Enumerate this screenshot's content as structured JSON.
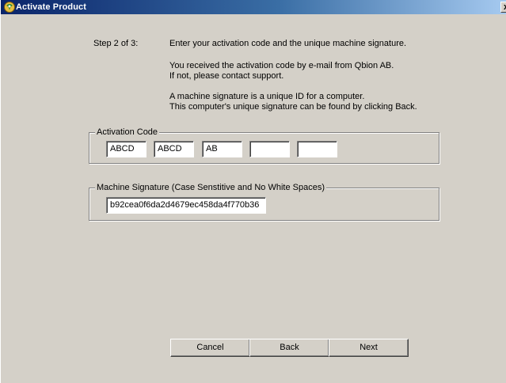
{
  "window": {
    "title": "Activate Product",
    "close_glyph": "x"
  },
  "step": {
    "label": "Step 2 of 3:"
  },
  "instructions": {
    "line1": "Enter your activation code and the unique machine signature.",
    "line2": "You received the activation code by e-mail from Qbion AB.",
    "line3": "If not, please contact support.",
    "line4": "A machine signature is a unique ID for a computer.",
    "line5": "This computer's unique signature can be found by clicking Back."
  },
  "activation": {
    "group_label": "Activation Code",
    "fields": [
      "ABCD",
      "ABCD",
      "AB",
      "",
      ""
    ]
  },
  "signature": {
    "group_label": "Machine Signature (Case Senstitive and No White Spaces)",
    "value": "b92cea0f6da2d4679ec458da4f770b36"
  },
  "buttons": {
    "cancel": "Cancel",
    "back": "Back",
    "next": "Next"
  },
  "colors": {
    "dialog_face": "#d4d0c8",
    "titlebar_start": "#0a246a",
    "titlebar_end": "#a6caf0"
  },
  "icons": {
    "title_icon": "app-logo-icon"
  }
}
